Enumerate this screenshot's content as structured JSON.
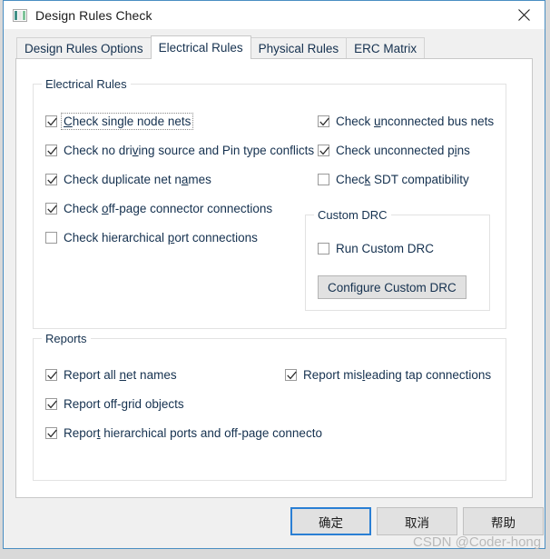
{
  "window": {
    "title": "Design Rules Check",
    "icon": "app-window-icon",
    "close_icon": "close-icon",
    "accent_color": "#4a8ec2",
    "background": "#f0f0f0"
  },
  "tabs": [
    {
      "label": "Design Rules Options",
      "active": false
    },
    {
      "label": "Electrical Rules",
      "active": true
    },
    {
      "label": "Physical Rules",
      "active": false
    },
    {
      "label": "ERC Matrix",
      "active": false
    }
  ],
  "groups": {
    "electrical": {
      "label": "Electrical Rules"
    },
    "custom_drc": {
      "label": "Custom DRC"
    },
    "reports": {
      "label": "Reports"
    }
  },
  "electrical_rules": {
    "left_column": [
      {
        "label_before": "",
        "mnemonic": "C",
        "label_after": "heck single node nets",
        "checked": true,
        "focused": true
      },
      {
        "label_before": "Check no dri",
        "mnemonic": "v",
        "label_after": "ing source and Pin type conflicts",
        "checked": true,
        "focused": false
      },
      {
        "label_before": "Check duplicate net n",
        "mnemonic": "a",
        "label_after": "mes",
        "checked": true,
        "focused": false
      },
      {
        "label_before": "Check ",
        "mnemonic": "o",
        "label_after": "ff-page connector connections",
        "checked": true,
        "focused": false
      },
      {
        "label_before": "Check hierarchical ",
        "mnemonic": "p",
        "label_after": "ort connections",
        "checked": false,
        "focused": false
      }
    ],
    "right_column": [
      {
        "label_before": "Check ",
        "mnemonic": "u",
        "label_after": "nconnected bus nets",
        "checked": true,
        "focused": false
      },
      {
        "label_before": "Check unconnected p",
        "mnemonic": "i",
        "label_after": "ns",
        "checked": true,
        "focused": false
      },
      {
        "label_before": "Chec",
        "mnemonic": "k",
        "label_after": " SDT compatibility",
        "checked": false,
        "focused": false
      }
    ]
  },
  "custom_drc": {
    "run_checkbox": {
      "label_before": "Run Custom DRC",
      "mnemonic": "",
      "label_after": "",
      "checked": false,
      "focused": false
    },
    "configure_button": "Configure Custom DRC"
  },
  "reports": {
    "left_column": [
      {
        "label_before": "Report all ",
        "mnemonic": "n",
        "label_after": "et names",
        "checked": true,
        "focused": false
      },
      {
        "label_before": "Report off-",
        "mnemonic": "g",
        "label_after": "rid objects",
        "checked": true,
        "focused": false
      },
      {
        "label_before": "Repor",
        "mnemonic": "t",
        "label_after": " hierarchical ports and off-page connecto",
        "checked": true,
        "focused": false
      }
    ],
    "right_column": [
      {
        "label_before": "Report mis",
        "mnemonic": "l",
        "label_after": "eading tap connections",
        "checked": true,
        "focused": false
      }
    ]
  },
  "footer": {
    "ok_label": "确定",
    "cancel_label": "取消",
    "help_label": "帮助"
  },
  "watermark": "CSDN @Coder-hong"
}
